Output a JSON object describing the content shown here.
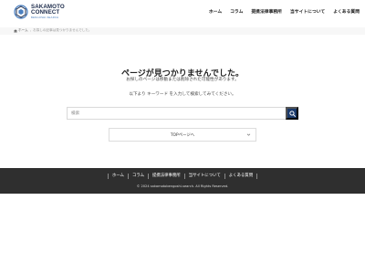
{
  "header": {
    "logo": {
      "line1": "SAKAMOTO",
      "line2": "CONNECT",
      "tagline": "BENGOSHI-SEARCH"
    },
    "nav": [
      {
        "label": "ホーム"
      },
      {
        "label": "コラム"
      },
      {
        "label": "提携法律事務所"
      },
      {
        "label": "当サイトについて"
      },
      {
        "label": "よくある質問"
      }
    ]
  },
  "breadcrumb": {
    "home": "ホーム",
    "current": "お探しの記事は見つかりませんでした。"
  },
  "main": {
    "title": "ページが見つかりませんでした。",
    "description": "お探しのページは移動または削除された可能性があります。",
    "instruction": "以下より キーワード を入力して検索してみてください。",
    "search_placeholder": "検索",
    "top_link": "TOPページへ"
  },
  "footer": {
    "nav": [
      {
        "label": "ホーム"
      },
      {
        "label": "コラム"
      },
      {
        "label": "提携法律事務所"
      },
      {
        "label": "当サイトについて"
      },
      {
        "label": "よくある質問"
      }
    ],
    "copyright": "© 2024 sakamotobengoshi-search. All Rights Reserved."
  },
  "colors": {
    "brand_navy": "#1b3a6b",
    "footer_bg": "#2f2f2f",
    "logo_blue": "#4a7fc0"
  }
}
